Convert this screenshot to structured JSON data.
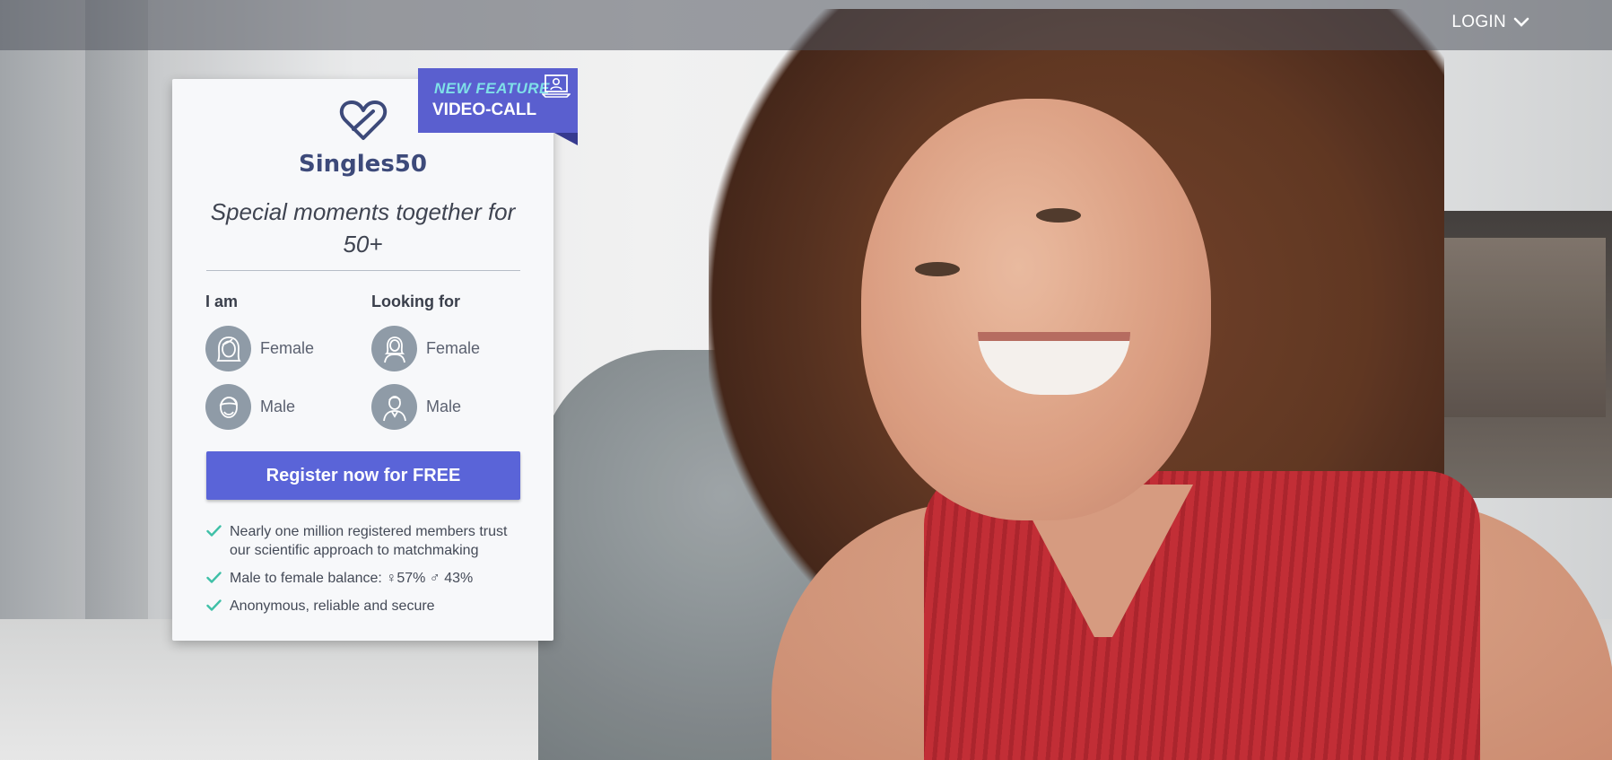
{
  "header": {
    "login_label": "LOGIN"
  },
  "brand": {
    "name": "Singles50",
    "tagline": "Special moments together for 50+"
  },
  "badge": {
    "line1": "NEW FEATURE",
    "line2": "VIDEO-CALL"
  },
  "form": {
    "iam_label": "I am",
    "looking_label": "Looking for",
    "iam_options": [
      "Female",
      "Male"
    ],
    "looking_options": [
      "Female",
      "Male"
    ],
    "register_label": "Register now for FREE"
  },
  "benefits": [
    "Nearly one million registered members trust our scientific approach to matchmaking",
    "Male to female balance: ♀57% ♂ 43%",
    "Anonymous, reliable and secure"
  ],
  "colors": {
    "accent": "#5a64d8",
    "brand": "#3d4a7a",
    "check": "#3fc0a7",
    "badge_text": "#7fe0e8"
  }
}
